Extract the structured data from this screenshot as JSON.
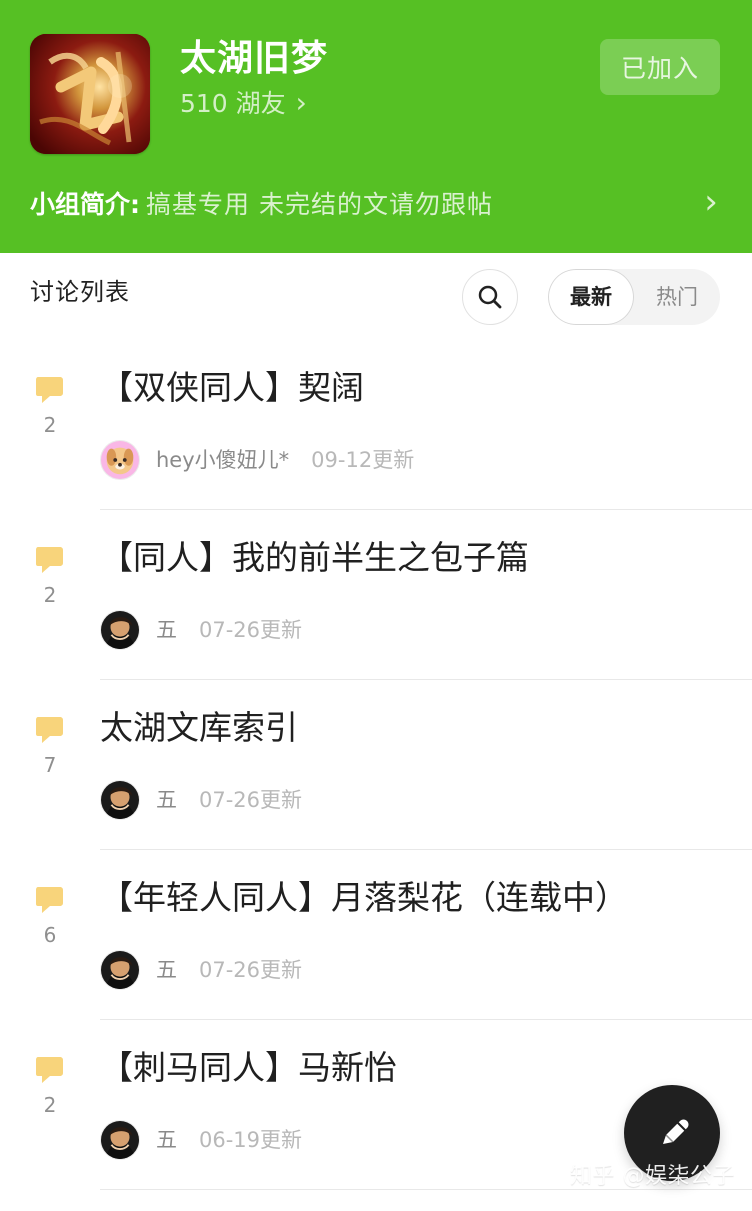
{
  "group": {
    "title": "太湖旧梦",
    "members": "510 湖友",
    "member_chevron": "›",
    "joined_label": "已加入",
    "intro_label": "小组简介:",
    "intro_text": "搞基专用  未完结的文请勿跟帖",
    "intro_chevron": "›",
    "cover_icon": "group-cover-image"
  },
  "discussion": {
    "title": "讨论列表",
    "search_icon": "search-icon",
    "sort_tabs": [
      {
        "label": "最新",
        "selected": true
      },
      {
        "label": "热门",
        "selected": false
      }
    ]
  },
  "topics": [
    {
      "comments": "2",
      "title": "【双侠同人】契阔",
      "author": "hey小傻妞儿*",
      "updated": "09-12更新",
      "avatar": "dog-avatar"
    },
    {
      "comments": "2",
      "title": "【同人】我的前半生之包子篇",
      "author": "五",
      "updated": "07-26更新",
      "avatar": "person-avatar"
    },
    {
      "comments": "7",
      "title": "太湖文库索引",
      "author": "五",
      "updated": "07-26更新",
      "avatar": "person-avatar"
    },
    {
      "comments": "6",
      "title": "【年轻人同人】月落梨花（连载中）",
      "author": "五",
      "updated": "07-26更新",
      "avatar": "person-avatar"
    },
    {
      "comments": "2",
      "title": "【刺马同人】马新怡",
      "author": "五",
      "updated": "06-19更新",
      "avatar": "person-avatar"
    }
  ],
  "fab": {
    "icon": "pencil-icon"
  },
  "watermark": "知乎 @娱柒公子",
  "colors": {
    "brand_green": "#56c024",
    "comment_icon": "#f8d47b",
    "text_primary": "#202020",
    "text_secondary": "#8a8a8a",
    "text_muted": "#b8b8b8"
  }
}
